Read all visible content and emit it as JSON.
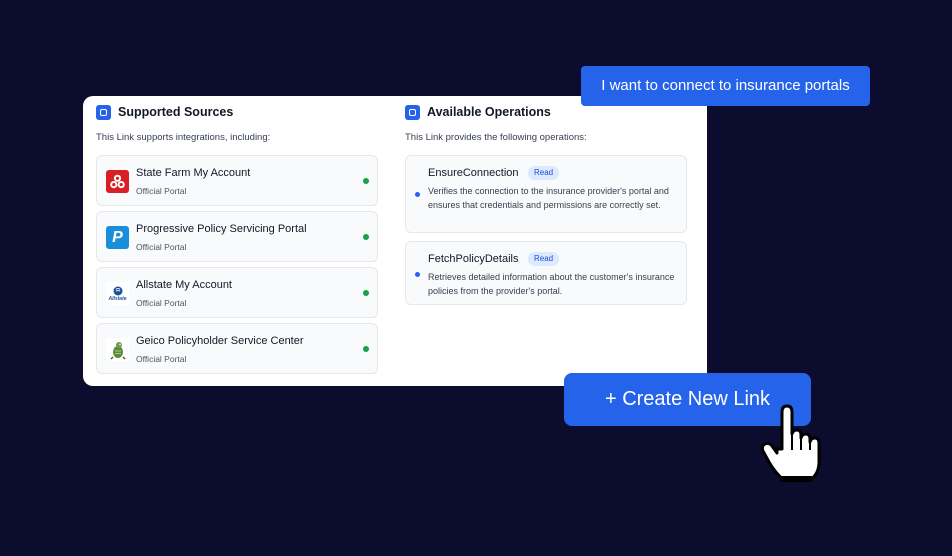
{
  "prompt": {
    "text": "I want to connect to insurance portals"
  },
  "sources": {
    "title": "Supported Sources",
    "subtitle": "This Link supports integrations, including:",
    "items": [
      {
        "name": "State Farm My Account",
        "sub": "Official Portal",
        "logo": "state-farm-logo",
        "status": "connected",
        "status_color": "#16a34a"
      },
      {
        "name": "Progressive Policy Servicing Portal",
        "sub": "Official Portal",
        "logo": "progressive-logo",
        "status": "connected",
        "status_color": "#16a34a"
      },
      {
        "name": "Allstate My Account",
        "sub": "Official Portal",
        "logo": "allstate-logo",
        "status": "connected",
        "status_color": "#16a34a"
      },
      {
        "name": "Geico Policyholder Service Center",
        "sub": "Official Portal",
        "logo": "geico-logo",
        "status": "connected",
        "status_color": "#16a34a"
      }
    ]
  },
  "operations": {
    "title": "Available Operations",
    "subtitle": "This Link provides the following operations:",
    "items": [
      {
        "name": "EnsureConnection",
        "badge": "Read",
        "desc": "Verifies the connection to the insurance provider's portal and ensures that credentials and permissions are correctly set."
      },
      {
        "name": "FetchPolicyDetails",
        "badge": "Read",
        "desc": "Retrieves detailed information about the customer's insurance policies from the provider's portal."
      }
    ]
  },
  "cta": {
    "label": "+ Create New Link"
  },
  "logo_text": {
    "progressive": "P",
    "allstate": "Allstate"
  },
  "colors": {
    "background": "#0b0c2e",
    "accent": "#2563eb",
    "status_green": "#16a34a",
    "badge_bg": "#dbeafe"
  }
}
